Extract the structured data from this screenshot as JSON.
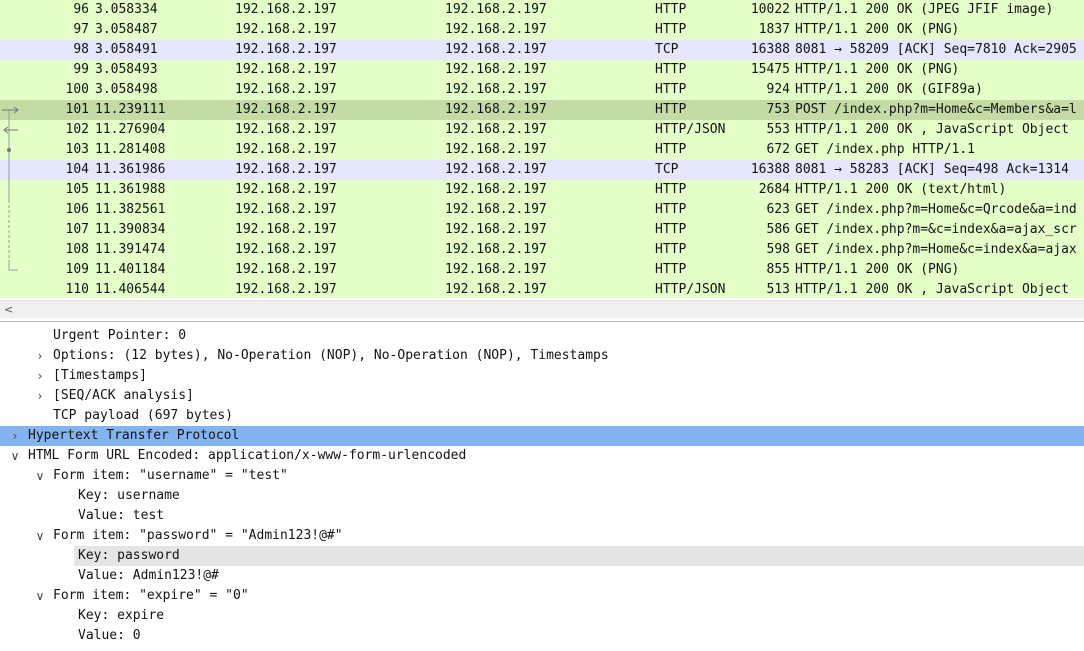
{
  "colors": {
    "http_row_bg": "#e4ffc7",
    "tcp_row_bg": "#e7e6ff",
    "selected_row_bg": "#c5dba6",
    "selected_detail_bg": "#84b4ef",
    "focus_detail_bg": "#e5e5e5"
  },
  "packets": [
    {
      "no": "96",
      "time": "3.058334",
      "src": "192.168.2.197",
      "dst": "192.168.2.197",
      "proto": "HTTP",
      "len": "10022",
      "info": "HTTP/1.1 200 OK  (JPEG JFIF image)",
      "type": "http"
    },
    {
      "no": "97",
      "time": "3.058487",
      "src": "192.168.2.197",
      "dst": "192.168.2.197",
      "proto": "HTTP",
      "len": "1837",
      "info": "HTTP/1.1 200 OK  (PNG)",
      "type": "http"
    },
    {
      "no": "98",
      "time": "3.058491",
      "src": "192.168.2.197",
      "dst": "192.168.2.197",
      "proto": "TCP",
      "len": "16388",
      "info": "8081 → 58209 [ACK] Seq=7810 Ack=2905",
      "type": "tcp"
    },
    {
      "no": "99",
      "time": "3.058493",
      "src": "192.168.2.197",
      "dst": "192.168.2.197",
      "proto": "HTTP",
      "len": "15475",
      "info": "HTTP/1.1 200 OK  (PNG)",
      "type": "http"
    },
    {
      "no": "100",
      "time": "3.058498",
      "src": "192.168.2.197",
      "dst": "192.168.2.197",
      "proto": "HTTP",
      "len": "924",
      "info": "HTTP/1.1 200 OK  (GIF89a)",
      "type": "http"
    },
    {
      "no": "101",
      "time": "11.239111",
      "src": "192.168.2.197",
      "dst": "192.168.2.197",
      "proto": "HTTP",
      "len": "753",
      "info": "POST /index.php?m=Home&c=Members&a=l",
      "type": "selected"
    },
    {
      "no": "102",
      "time": "11.276904",
      "src": "192.168.2.197",
      "dst": "192.168.2.197",
      "proto": "HTTP/JSON",
      "len": "553",
      "info": "HTTP/1.1 200 OK , JavaScript Object",
      "type": "http"
    },
    {
      "no": "103",
      "time": "11.281408",
      "src": "192.168.2.197",
      "dst": "192.168.2.197",
      "proto": "HTTP",
      "len": "672",
      "info": "GET /index.php HTTP/1.1",
      "type": "http"
    },
    {
      "no": "104",
      "time": "11.361986",
      "src": "192.168.2.197",
      "dst": "192.168.2.197",
      "proto": "TCP",
      "len": "16388",
      "info": "8081 → 58283 [ACK] Seq=498 Ack=1314",
      "type": "tcp"
    },
    {
      "no": "105",
      "time": "11.361988",
      "src": "192.168.2.197",
      "dst": "192.168.2.197",
      "proto": "HTTP",
      "len": "2684",
      "info": "HTTP/1.1 200 OK  (text/html)",
      "type": "http"
    },
    {
      "no": "106",
      "time": "11.382561",
      "src": "192.168.2.197",
      "dst": "192.168.2.197",
      "proto": "HTTP",
      "len": "623",
      "info": "GET /index.php?m=Home&c=Qrcode&a=ind",
      "type": "http"
    },
    {
      "no": "107",
      "time": "11.390834",
      "src": "192.168.2.197",
      "dst": "192.168.2.197",
      "proto": "HTTP",
      "len": "586",
      "info": "GET /index.php?m=&c=index&a=ajax_scr",
      "type": "http"
    },
    {
      "no": "108",
      "time": "11.391474",
      "src": "192.168.2.197",
      "dst": "192.168.2.197",
      "proto": "HTTP",
      "len": "598",
      "info": "GET /index.php?m=Home&c=index&a=ajax",
      "type": "http"
    },
    {
      "no": "109",
      "time": "11.401184",
      "src": "192.168.2.197",
      "dst": "192.168.2.197",
      "proto": "HTTP",
      "len": "855",
      "info": "HTTP/1.1 200 OK  (PNG)",
      "type": "http"
    },
    {
      "no": "110",
      "time": "11.406544",
      "src": "192.168.2.197",
      "dst": "192.168.2.197",
      "proto": "HTTP/JSON",
      "len": "513",
      "info": "HTTP/1.1 200 OK , JavaScript Object",
      "type": "http"
    }
  ],
  "details": [
    {
      "indent": 1,
      "expander": "none",
      "text": "Urgent Pointer: 0",
      "state": "normal"
    },
    {
      "indent": 1,
      "expander": "collapsed",
      "text": "Options: (12 bytes), No-Operation (NOP), No-Operation (NOP), Timestamps",
      "state": "normal"
    },
    {
      "indent": 1,
      "expander": "collapsed",
      "text": "[Timestamps]",
      "state": "normal"
    },
    {
      "indent": 1,
      "expander": "collapsed",
      "text": "[SEQ/ACK analysis]",
      "state": "normal"
    },
    {
      "indent": 1,
      "expander": "none",
      "text": "TCP payload (697 bytes)",
      "state": "normal"
    },
    {
      "indent": 0,
      "expander": "collapsed",
      "text": "Hypertext Transfer Protocol",
      "state": "selected"
    },
    {
      "indent": 0,
      "expander": "expanded",
      "text": "HTML Form URL Encoded: application/x-www-form-urlencoded",
      "state": "normal"
    },
    {
      "indent": 1,
      "expander": "expanded",
      "text": "Form item: \"username\" = \"test\"",
      "state": "normal"
    },
    {
      "indent": 2,
      "expander": "none",
      "text": "Key: username",
      "state": "normal"
    },
    {
      "indent": 2,
      "expander": "none",
      "text": "Value: test",
      "state": "normal"
    },
    {
      "indent": 1,
      "expander": "expanded",
      "text": "Form item: \"password\" = \"Admin123!@#\"",
      "state": "normal"
    },
    {
      "indent": 2,
      "expander": "none",
      "text": "Key: password",
      "state": "focus"
    },
    {
      "indent": 2,
      "expander": "none",
      "text": "Value: Admin123!@#",
      "state": "normal"
    },
    {
      "indent": 1,
      "expander": "expanded",
      "text": "Form item: \"expire\" = \"0\"",
      "state": "normal"
    },
    {
      "indent": 2,
      "expander": "none",
      "text": "Key: expire",
      "state": "normal"
    },
    {
      "indent": 2,
      "expander": "none",
      "text": "Value: 0",
      "state": "normal"
    }
  ],
  "scrollbar": {
    "left_arrow": "<"
  }
}
